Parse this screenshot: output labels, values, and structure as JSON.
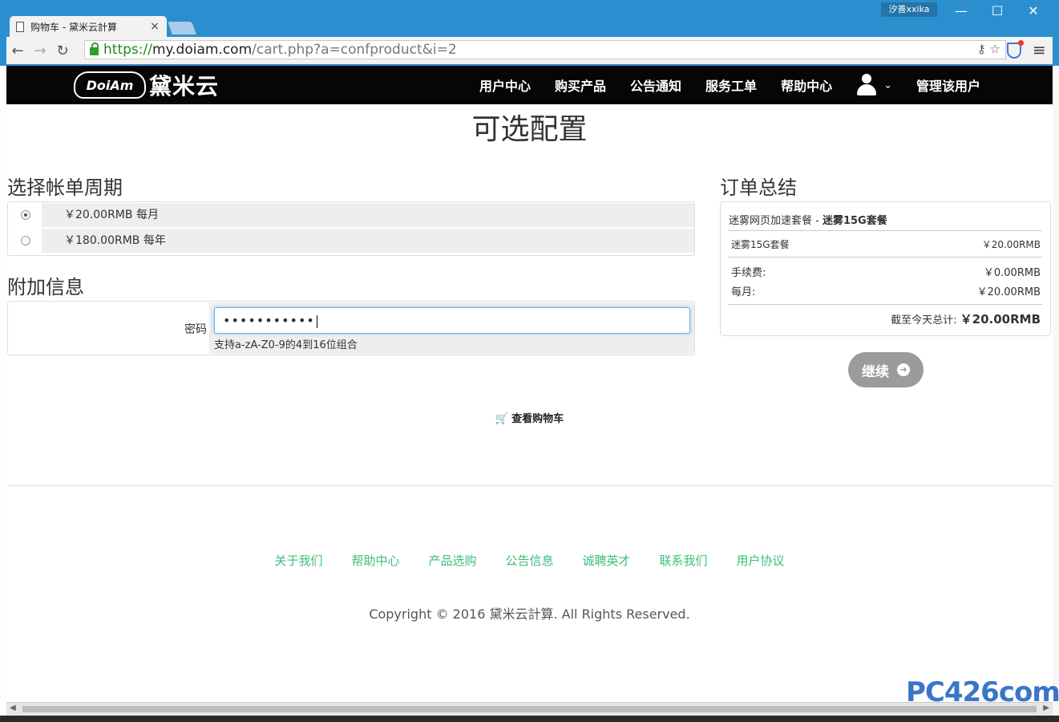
{
  "browser": {
    "tab_title": "购物车 - 黛米云計算",
    "tab_close": "×",
    "profile_name": "汐善xxika",
    "minimize": "—",
    "maximize": "☐",
    "close": "✕",
    "back": "←",
    "forward": "→",
    "reload": "↻",
    "url_scheme": "https://",
    "url_host": "my.doiam.com",
    "url_path": "/cart.php?a=confproduct&i=2",
    "key_icon": "⚷",
    "star_icon": "☆",
    "menu": "≡"
  },
  "site": {
    "logo_mark": "DoiAm",
    "logo_text": "黛米云",
    "nav": [
      "用户中心",
      "购买产品",
      "公告通知",
      "服务工单",
      "帮助中心"
    ],
    "caret": "⌄",
    "manage_user": "管理该用户"
  },
  "page": {
    "title": "可选配置",
    "billing_heading": "选择帐单周期",
    "billing_options": [
      {
        "label": "￥20.00RMB 每月",
        "selected": true
      },
      {
        "label": "￥180.00RMB 每年",
        "selected": false
      }
    ],
    "additional_heading": "附加信息",
    "password_label": "密码",
    "password_value": "•••••••••••|",
    "password_hint": "支持a-zA-Z0-9的4到16位组合",
    "summary_heading": "订单总结",
    "summary": {
      "product_group": "迷雾网页加速套餐 - ",
      "product_name": "迷雾15G套餐",
      "item_name": "迷雾15G套餐",
      "item_price": "￥20.00RMB",
      "fee_label": "手续费:",
      "fee_value": "￥0.00RMB",
      "monthly_label": "每月:",
      "monthly_value": "￥20.00RMB",
      "total_label": "截至今天总计: ",
      "total_value": "￥20.00RMB"
    },
    "continue_label": "继续",
    "continue_arrow": "➜",
    "view_cart": "查看购物车",
    "cart_icon": "🛒"
  },
  "footer": {
    "links": [
      "关于我们",
      "帮助中心",
      "产品选购",
      "公告信息",
      "诚聘英才",
      "联系我们",
      "用户协议"
    ],
    "copyright": "Copyright © 2016 黛米云計算. All Rights Reserved."
  },
  "watermark": "PC426com"
}
